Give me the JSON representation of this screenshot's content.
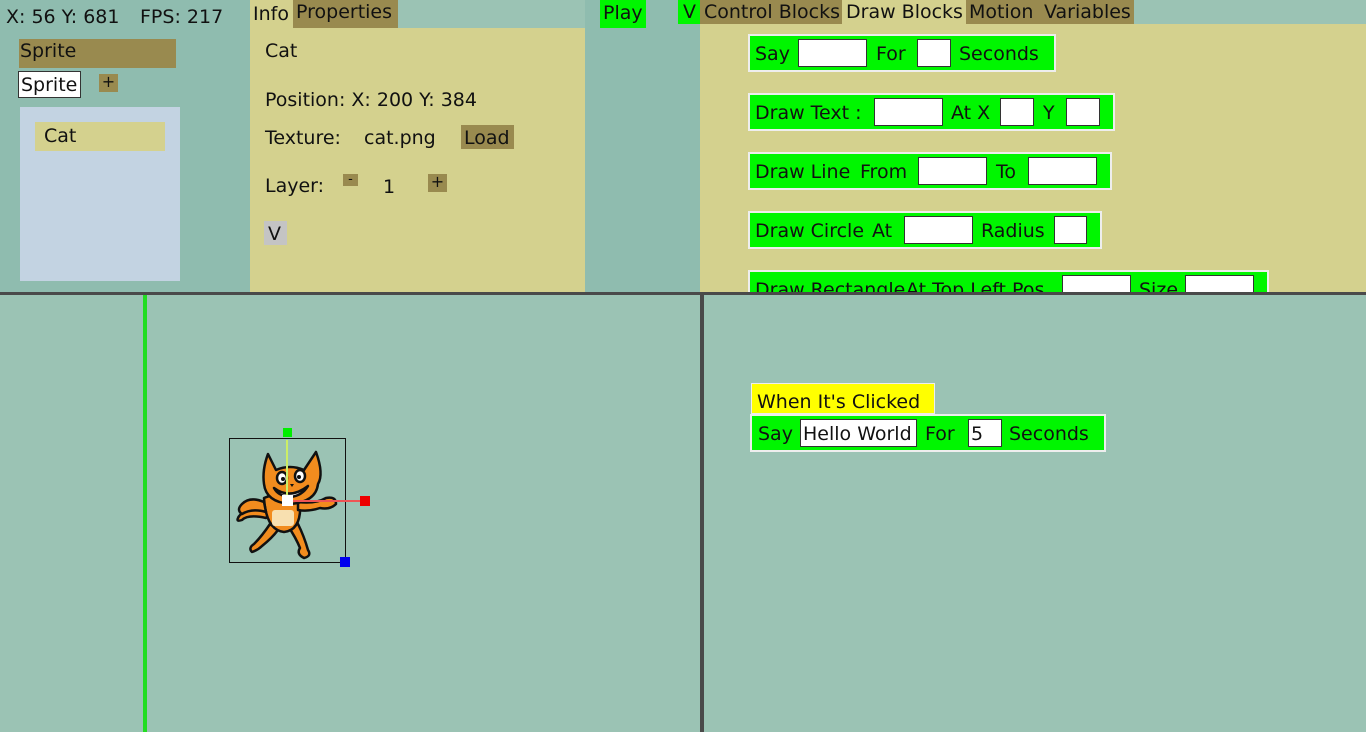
{
  "status": {
    "mouse": "X: 56 Y: 681",
    "fps": "FPS: 217"
  },
  "tabs_left": {
    "info": "Info",
    "properties": "Properties"
  },
  "play_label": "Play",
  "v_label": "V",
  "tabs_right": {
    "control": "Control Blocks",
    "draw": "Draw Blocks",
    "motion": "Motion",
    "variables": "Variables"
  },
  "sprite_panel": {
    "header": "Sprite",
    "name_input": "Sprite",
    "add_label": "+",
    "items": [
      "Cat"
    ]
  },
  "properties": {
    "name": "Cat",
    "position": "Position: X: 200 Y: 384",
    "texture_label": "Texture:",
    "texture_file": "cat.png",
    "load_label": "Load",
    "layer_label": "Layer:",
    "layer_minus": "-",
    "layer_value": "1",
    "layer_plus": "+",
    "v_button": "V"
  },
  "palette": {
    "say": {
      "say": "Say",
      "for": "For",
      "seconds": "Seconds"
    },
    "draw_text": {
      "label": "Draw Text :",
      "at_x": "At X",
      "y": "Y"
    },
    "draw_line": {
      "label": "Draw Line",
      "from": "From",
      "to": "To"
    },
    "draw_circle": {
      "label": "Draw Circle",
      "at": "At",
      "radius": "Radius"
    },
    "draw_rect": {
      "label": "Draw Rectangle",
      "at_top_left": "At Top Left Pos",
      "size": "Size"
    }
  },
  "script": {
    "event": "When It's Clicked",
    "say": "Say",
    "message": "Hello World",
    "for": "For",
    "duration": "5",
    "seconds": "Seconds"
  },
  "colors": {
    "background": "#9bc3b4",
    "panel": "#d4d18e",
    "tab": "#998a4f",
    "block": "#00f600",
    "event_block": "#ffff00"
  },
  "icons": {
    "sprite": "cat-sprite"
  }
}
